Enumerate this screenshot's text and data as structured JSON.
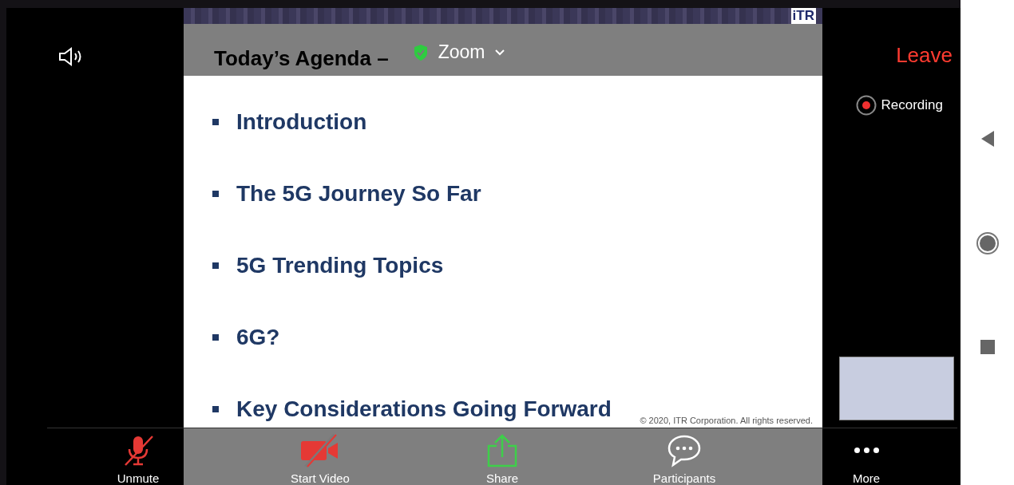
{
  "top_bar": {
    "meeting_title": "Zoom",
    "leave_label": "Leave"
  },
  "slide": {
    "logo": "iTR",
    "title": "Today’s Agenda –",
    "bullets": [
      "Introduction",
      "The 5G Journey So Far",
      "5G Trending Topics",
      "6G?",
      "Key Considerations Going Forward"
    ],
    "copyright": "© 2020, ITR Corporation. All rights reserved."
  },
  "recording": {
    "label": "Recording"
  },
  "toolbar": [
    {
      "kind": "mic",
      "label": "Unmute",
      "off": true
    },
    {
      "kind": "video",
      "label": "Start Video",
      "off": true
    },
    {
      "kind": "share",
      "label": "Share"
    },
    {
      "kind": "participants",
      "label": "Participants"
    },
    {
      "kind": "more",
      "label": "More"
    }
  ]
}
